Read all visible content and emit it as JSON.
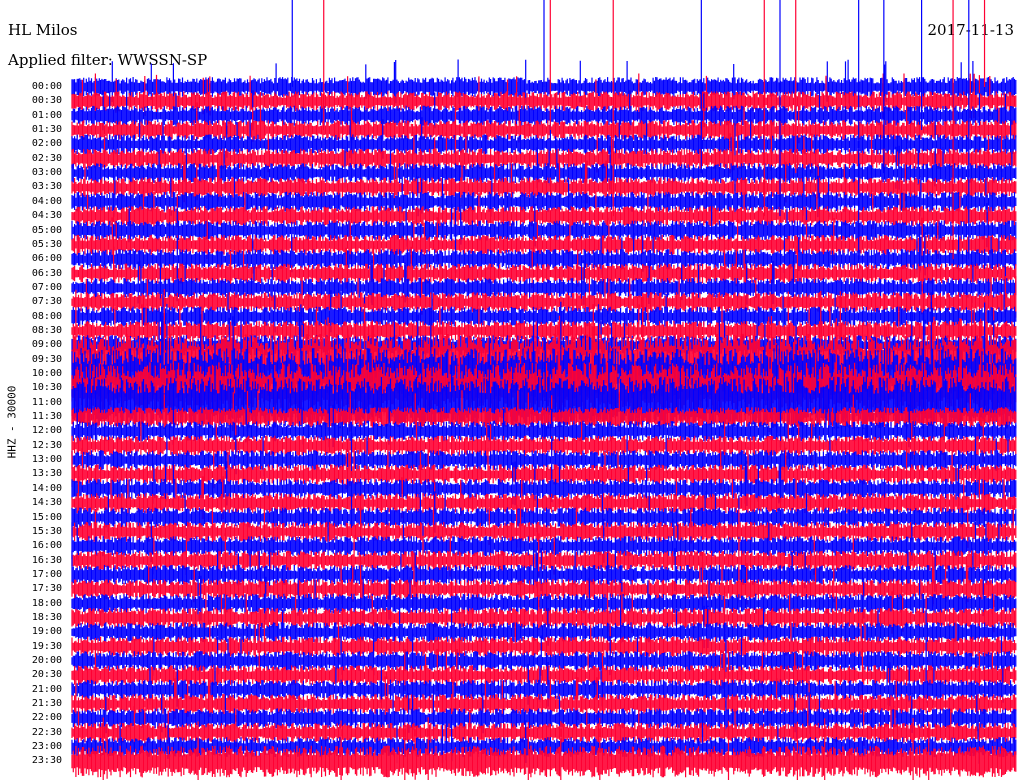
{
  "header": {
    "station": "HL Milos",
    "date": "2017-11-13",
    "filter": "Applied filter: WWSSN-SP"
  },
  "chart_data": {
    "type": "line",
    "title": "HL Milos",
    "date": "2017-11-13",
    "filter": "Applied filter: WWSSN-SP",
    "ylabel": "HHZ - 30000",
    "row_labels": [
      "00:00",
      "00:30",
      "01:00",
      "01:30",
      "02:00",
      "02:30",
      "03:00",
      "03:30",
      "04:00",
      "04:30",
      "05:00",
      "05:30",
      "06:00",
      "06:30",
      "07:00",
      "07:30",
      "08:00",
      "08:30",
      "09:00",
      "09:30",
      "10:00",
      "10:30",
      "11:00",
      "11:30",
      "12:00",
      "12:30",
      "13:00",
      "13:30",
      "14:00",
      "14:30",
      "15:00",
      "15:30",
      "16:00",
      "16:30",
      "17:00",
      "17:30",
      "18:00",
      "18:30",
      "19:00",
      "19:30",
      "20:00",
      "20:30",
      "21:00",
      "21:30",
      "22:00",
      "22:30",
      "23:00",
      "23:30"
    ],
    "series": [
      {
        "color": "#0000ff",
        "rows": "even"
      },
      {
        "color": "#ff0033",
        "rows": "odd"
      }
    ],
    "minutes_per_row": 30,
    "saturated_interval": {
      "start": "09:30",
      "end": "11:00"
    },
    "spikes_minutes": [
      7,
      8,
      20,
      22,
      25,
      29,
      27,
      23,
      22.5,
      28,
      15,
      15.2,
      25.8,
      17.2,
      28.5
    ]
  }
}
